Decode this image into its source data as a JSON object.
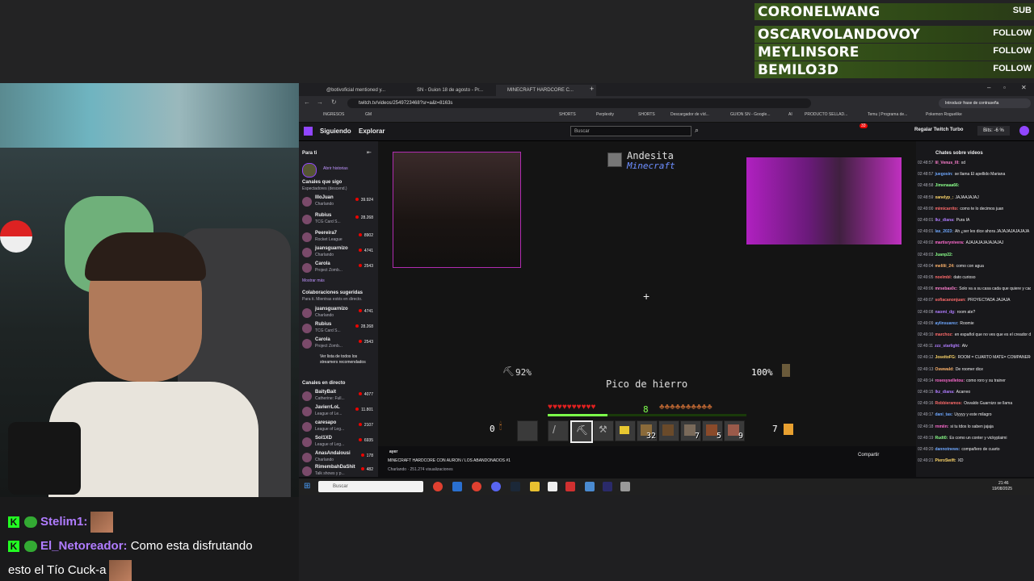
{
  "alerts": [
    {
      "name": "CORONELWANG",
      "action": "SUB"
    },
    {
      "name": "OSCARVOLANDOVOY",
      "action": "FOLLOW"
    },
    {
      "name": "MEYLINSORE",
      "action": "FOLLOW"
    },
    {
      "name": "BEMILO3D",
      "action": "FOLLOW"
    }
  ],
  "stream_chat": [
    {
      "user": "Stelim1:",
      "text": ""
    },
    {
      "user": "El_Netoreador:",
      "text": "Como esta disfrutando",
      "cont": "esto el Tío Cuck-a"
    }
  ],
  "browser": {
    "tabs": [
      {
        "label": "@botivoficial mentioned y..."
      },
      {
        "label": "SN - Guion 18 de agosto - Pr..."
      },
      {
        "label": "MINECRAFT HARDCORE C..."
      }
    ],
    "url": "twitch.tv/videos/2549723468?sr=a&t=8163s",
    "password_hint": "Introducir frase de contraseña",
    "bookmarks": [
      "INGRESOS",
      "GM",
      "Perplexity",
      "SHORTS",
      "SHORTS",
      "Descargador de víd...",
      "GUION SN - Google...",
      "AI",
      "PRODUCTO SELLAD...",
      "Temu | Programa de...",
      "Pokemon Roguelike"
    ]
  },
  "twitch": {
    "nav": {
      "following": "Siguiendo",
      "explore": "Explorar",
      "search_placeholder": "Buscar",
      "turbo": "Regalar Twitch Turbo",
      "bits": "Bits: -6 %",
      "notif_count": "33"
    },
    "sidebar": {
      "for_you": "Para ti",
      "stories": "Abrir historias",
      "followed_header": "Canales que sigo",
      "followed_sub": "Espectadores (descend.)",
      "followed": [
        {
          "name": "IlloJuan",
          "game": "Charlando",
          "viewers": "39.924"
        },
        {
          "name": "Rubius",
          "game": "TCG Card S...",
          "viewers": "28.268"
        },
        {
          "name": "Peereira7",
          "game": "Rocket League",
          "viewers": "8902"
        },
        {
          "name": "juansguarnizo",
          "game": "Charlando",
          "viewers": "4741"
        },
        {
          "name": "Carola",
          "game": "Project Zomb...",
          "viewers": "2543"
        }
      ],
      "show_more": "Mostrar más",
      "collab_header": "Colaboraciones sugeridas",
      "collab_sub": "Para ti. Mientras estés en directo.",
      "collab": [
        {
          "name": "juansguarnizo",
          "game": "Charlando",
          "viewers": "4741"
        },
        {
          "name": "Rubius",
          "game": "TCG Card S...",
          "viewers": "28.268"
        },
        {
          "name": "Carola",
          "game": "Project Zomb...",
          "viewers": "2543"
        }
      ],
      "see_list": "Ver lista de todos los streamers recomendados",
      "live_header": "Canales en directo",
      "live": [
        {
          "name": "BaityBait",
          "game": "Catherine: Full...",
          "viewers": "4077"
        },
        {
          "name": "JavierrLoL",
          "game": "League of Le...",
          "viewers": "11.801"
        },
        {
          "name": "caresapo",
          "game": "League of Leg...",
          "viewers": "2107"
        },
        {
          "name": "Sol1XD",
          "game": "League of Leg...",
          "viewers": "6935"
        },
        {
          "name": "AnasAndalousi",
          "game": "Charlando",
          "viewers": "178"
        },
        {
          "name": "RimembahDaShit",
          "game": "Talk shows y p...",
          "viewers": "482"
        }
      ]
    },
    "game": {
      "block_name": "Andesita",
      "block_source": "Minecraft",
      "pick_durability": "92%",
      "item_name": "Pico de hierro",
      "armor": "100%",
      "level": "8",
      "left_count": "0",
      "right_count": "7",
      "slot_counts": [
        "32",
        "7",
        "5",
        "9"
      ]
    },
    "video": {
      "date": "ayer",
      "title": "MINECRAFT HARDCORE CON AURON / LOS ABANDONADOS #1",
      "meta": "Charlando · 251.274 visualizaciones",
      "share": "Compartir"
    },
    "chat": {
      "header": "Chates sobre videos",
      "lines": [
        {
          "t": "02:48:57",
          "u": "lil_Venus_lll:",
          "m": "xd",
          "c": "#ff7fd0"
        },
        {
          "t": "02:48:57",
          "u": "juegosin:",
          "m": "se llama El apellido Mariana",
          "c": "#6fa8ff"
        },
        {
          "t": "02:48:58",
          "u": "Jimenaaa66:",
          "m": "",
          "c": "#8aff8a"
        },
        {
          "t": "02:48:59",
          "u": "xanelyp_:",
          "m": "JAJAAJAJAJ",
          "c": "#ffd86b"
        },
        {
          "t": "02:49:00",
          "u": "mimicarrito:",
          "m": "como te lo decimos juan",
          "c": "#ff6b6b"
        },
        {
          "t": "02:49:01",
          "u": "lkz_diana:",
          "m": "Pura IA",
          "c": "#b07cff"
        },
        {
          "t": "02:49:01",
          "u": "las_2023:",
          "m": "Ah ¿ser les dice ahora JAJAJAJAJAJAJA",
          "c": "#6fa8ff"
        },
        {
          "t": "02:49:02",
          "u": "martisrynivera:",
          "m": "AJAJAJAJAJAJAJAJ",
          "c": "#ff6bd0"
        },
        {
          "t": "02:49:03",
          "u": "Juanp22:",
          "m": "",
          "c": "#8aff8a"
        },
        {
          "t": "02:49:04",
          "u": "melilii_24:",
          "m": "como con agua",
          "c": "#ffb36b"
        },
        {
          "t": "02:49:05",
          "u": "noelmbl:",
          "m": "dato curioso",
          "c": "#ff6b6b"
        },
        {
          "t": "02:49:06",
          "u": "mrsebas0c:",
          "m": "Solo va a su casa cada que quiere y cada que puede",
          "c": "#ff7fd0"
        },
        {
          "t": "02:49:07",
          "u": "sofiacanonjuan:",
          "m": "PROYECTADA JAJAJA",
          "c": "#ff6b6b"
        },
        {
          "t": "02:49:08",
          "u": "naomi_dg:",
          "m": "room ate?",
          "c": "#b07cff"
        },
        {
          "t": "02:49:09",
          "u": "aylinsuarez:",
          "m": "Roomie",
          "c": "#6fa8ff"
        },
        {
          "t": "02:49:10",
          "u": "marchoz:",
          "m": "en español que no ves que es el creador del idioma el calvo",
          "c": "#ff6b6b"
        },
        {
          "t": "02:49:11",
          "u": "zzz_starlight:",
          "m": "Alv",
          "c": "#b07cff"
        },
        {
          "t": "02:49:12",
          "u": "JoseitoFG:",
          "m": "ROOM = CUARTO MATE= COMPAÑERO",
          "c": "#ffd86b"
        },
        {
          "t": "02:49:13",
          "u": "Oswwald:",
          "m": "De roomer dice",
          "c": "#ffb36b"
        },
        {
          "t": "02:49:14",
          "u": "rosesyselletou:",
          "m": "como roro y su trainer",
          "c": "#ff6bd0"
        },
        {
          "t": "02:49:15",
          "u": "lkz_diana:",
          "m": "Acarreo",
          "c": "#b07cff"
        },
        {
          "t": "02:49:16",
          "u": "Robbieramos:",
          "m": "Osvaldo Guarnizo se llama",
          "c": "#ff6b6b"
        },
        {
          "t": "02:49:17",
          "u": "dani_tas:",
          "m": "Uyyyy y este milagro",
          "c": "#6fa8ff"
        },
        {
          "t": "02:49:18",
          "u": "rnmiin:",
          "m": "si tu tdos lo saben jajaja",
          "c": "#ff6bd0"
        },
        {
          "t": "02:49:19",
          "u": "Rudt0:",
          "m": "Es como un conter y vickyplaimi",
          "c": "#8aff8a"
        },
        {
          "t": "02:49:20",
          "u": "dannotnews:",
          "m": "compañero de cuarto",
          "c": "#6fa8ff"
        },
        {
          "t": "02:49:21",
          "u": "PieroSwift:",
          "m": "XD",
          "c": "#ffd86b"
        }
      ]
    }
  },
  "taskbar": {
    "search_placeholder": "Buscar",
    "time": "21:46",
    "date": "19/08/2025"
  },
  "colors": {
    "twitch_purple": "#9146ff",
    "alert_green": "#3a5a1c"
  }
}
